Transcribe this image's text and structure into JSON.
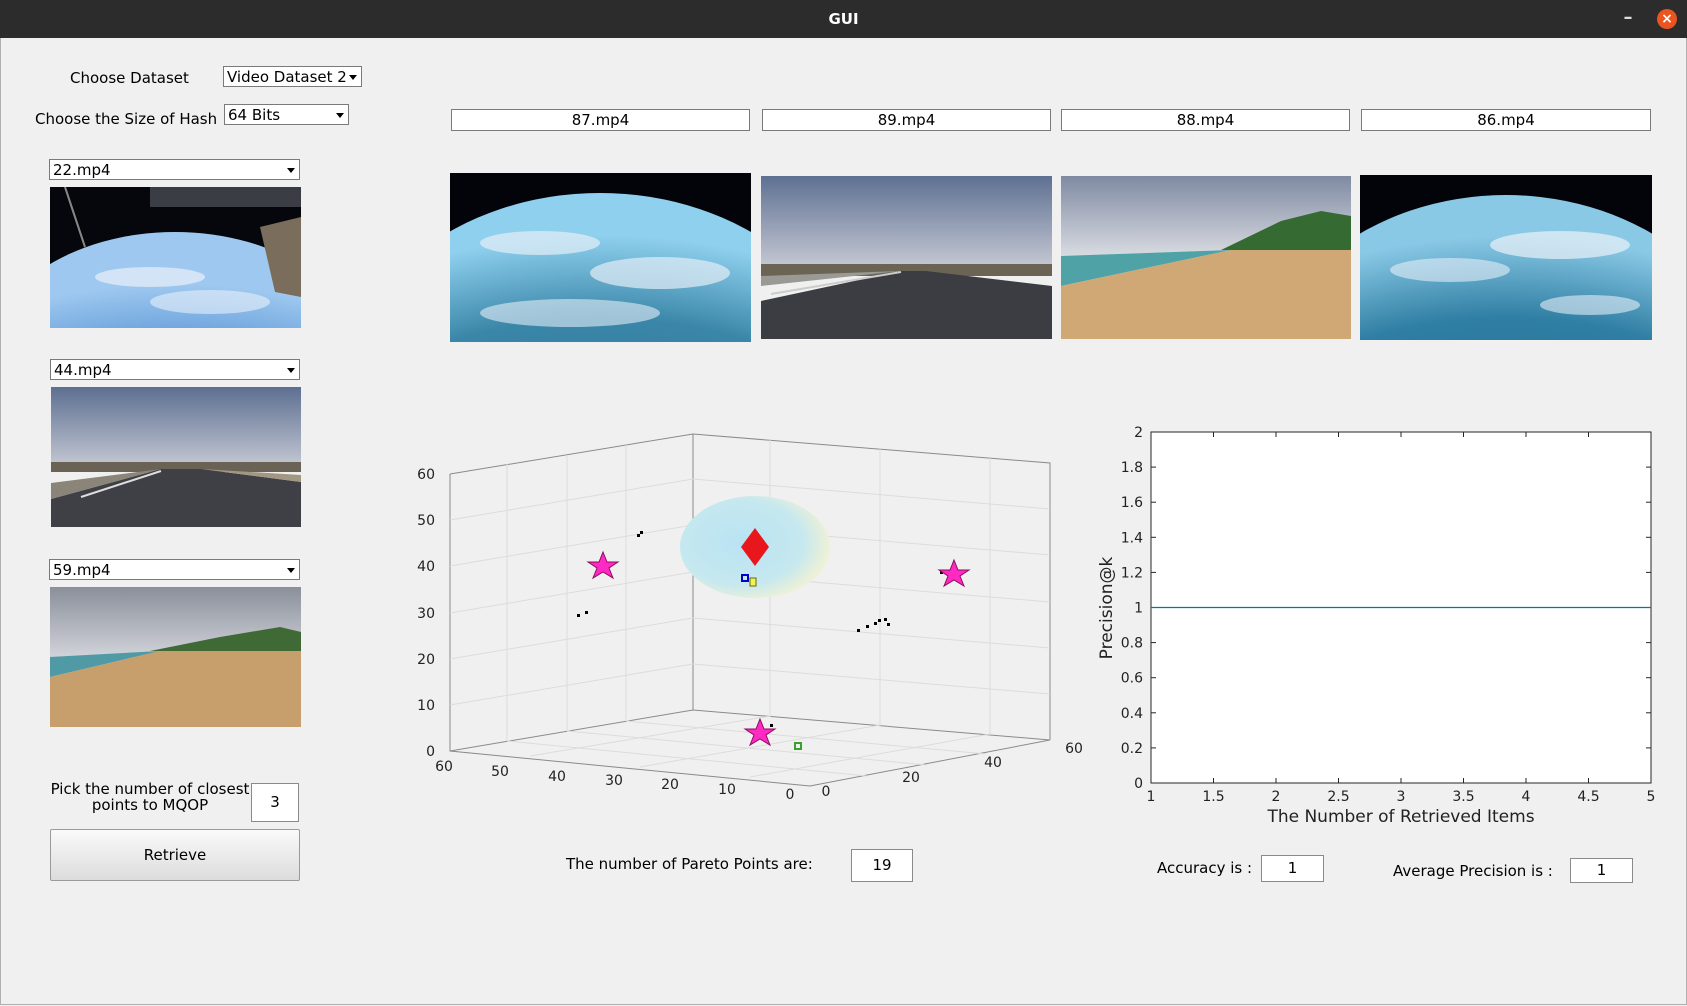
{
  "window": {
    "title": "GUI",
    "minimize_glyph": "–",
    "close_glyph": "×"
  },
  "controls": {
    "dataset_label": "Choose  Dataset",
    "dataset_value": "Video Dataset 2",
    "hash_label": "Choose the Size of Hash",
    "hash_value": "64  Bits"
  },
  "queries": [
    {
      "file": "22.mp4",
      "scene": "earth"
    },
    {
      "file": "44.mp4",
      "scene": "road"
    },
    {
      "file": "59.mp4",
      "scene": "beach"
    }
  ],
  "results": [
    {
      "file": "87.mp4",
      "scene": "earth"
    },
    {
      "file": "89.mp4",
      "scene": "road"
    },
    {
      "file": "88.mp4",
      "scene": "beach"
    },
    {
      "file": "86.mp4",
      "scene": "earth"
    }
  ],
  "closest": {
    "label_line1": "Pick the number of closest",
    "label_line2": "points to MQOP",
    "value": "3",
    "retrieve_label": "Retrieve"
  },
  "pareto": {
    "label": "The number of Pareto Points are:",
    "value": "19"
  },
  "metrics": {
    "accuracy_label": "Accuracy is  :",
    "accuracy_value": "1",
    "ap_label": "Average Precision is  :",
    "ap_value": "1"
  },
  "plot3d": {
    "z_ticks": [
      "0",
      "10",
      "20",
      "30",
      "40",
      "50",
      "60"
    ],
    "x_ticks": [
      "60",
      "50",
      "40",
      "30",
      "20",
      "10",
      "0"
    ],
    "y_ticks": [
      "0",
      "20",
      "40",
      "60"
    ]
  },
  "chart_data": {
    "type": "line",
    "title": "",
    "xlabel": "The Number of Retrieved Items",
    "ylabel": "Precision@k",
    "xlim": [
      1,
      5
    ],
    "ylim": [
      0,
      2
    ],
    "x_ticks": [
      "1",
      "1.5",
      "2",
      "2.5",
      "3",
      "3.5",
      "4",
      "4.5",
      "5"
    ],
    "y_ticks": [
      "0",
      "0.2",
      "0.4",
      "0.6",
      "0.8",
      "1",
      "1.2",
      "1.4",
      "1.6",
      "1.8",
      "2"
    ],
    "grid": false,
    "series": [
      {
        "x": [
          1,
          2,
          3,
          4,
          5
        ],
        "y": [
          1,
          1,
          1,
          1,
          1
        ],
        "color": "#0072bd"
      }
    ]
  }
}
